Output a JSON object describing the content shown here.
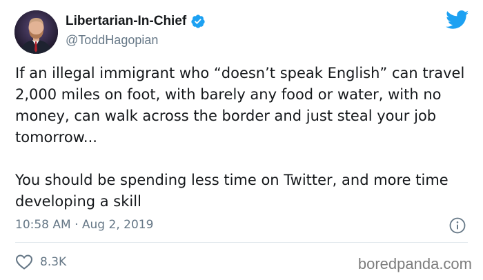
{
  "author": {
    "display_name": "Libertarian-In-Chief",
    "handle": "@ToddHagopian",
    "verified": true
  },
  "tweet": {
    "paragraphs": [
      "If an illegal immigrant who “doesn’t speak English” can travel 2,000 miles on foot, with barely any food or water, with no money, can walk across the border and just steal your job tomorrow...",
      "You should be spending less time on Twitter, and more time developing a skill"
    ],
    "timestamp": "10:58 AM · Aug 2, 2019"
  },
  "actions": {
    "like_count": "8.3K"
  },
  "watermark": "boredpanda.com",
  "icons": {
    "verified": "verified-badge-icon",
    "brand": "twitter-bird-icon",
    "info": "info-icon",
    "like": "heart-icon"
  },
  "colors": {
    "twitter_blue": "#1da1f2",
    "text_primary": "#14171a",
    "text_secondary": "#657786",
    "divider": "#e1e8ed"
  }
}
